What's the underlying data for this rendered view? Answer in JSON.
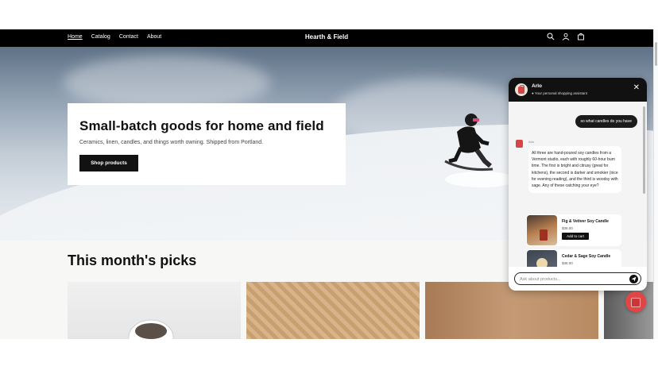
{
  "nav": {
    "links": [
      "Home",
      "Catalog",
      "Contact",
      "About"
    ],
    "brand": "Hearth & Field",
    "icons": [
      "search-icon",
      "account-icon",
      "cart-icon"
    ]
  },
  "hero": {
    "title": "Small-batch goods for home and field",
    "subtitle": "Ceramics, linen, candles, and things worth owning. Shipped from Portland.",
    "button": "Shop products"
  },
  "picks": {
    "title": "This month's picks"
  },
  "chat": {
    "assistant_name": "Arlo",
    "tagline": "Your personal shopping assistant",
    "user_message": "so what candles do you have",
    "bot_label": "Arlo",
    "bot_message": "All three are hand-poured soy candles from a Vermont studio, each with roughly 60-hour burn time. The first is bright and citrusy (great for kitchens), the second is darker and smokier (nice for evening reading), and the third is woodsy with sage. Any of these catching your eye?",
    "products": [
      {
        "name": "Fig & Vetiver Soy Candle",
        "price": "$38.00",
        "button": "Add to cart"
      },
      {
        "name": "Cedar & Sage Soy Candle",
        "price": "$38.00"
      }
    ],
    "input_placeholder": "Ask about products...",
    "colors": {
      "accent": "#d64545",
      "header": "#111111"
    }
  }
}
